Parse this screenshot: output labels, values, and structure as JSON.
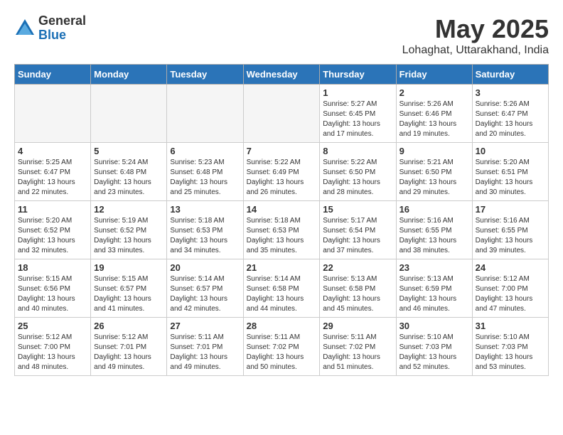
{
  "logo": {
    "general": "General",
    "blue": "Blue"
  },
  "title": "May 2025",
  "location": "Lohaghat, Uttarakhand, India",
  "headers": [
    "Sunday",
    "Monday",
    "Tuesday",
    "Wednesday",
    "Thursday",
    "Friday",
    "Saturday"
  ],
  "weeks": [
    [
      {
        "day": "",
        "info": ""
      },
      {
        "day": "",
        "info": ""
      },
      {
        "day": "",
        "info": ""
      },
      {
        "day": "",
        "info": ""
      },
      {
        "day": "1",
        "info": "Sunrise: 5:27 AM\nSunset: 6:45 PM\nDaylight: 13 hours\nand 17 minutes."
      },
      {
        "day": "2",
        "info": "Sunrise: 5:26 AM\nSunset: 6:46 PM\nDaylight: 13 hours\nand 19 minutes."
      },
      {
        "day": "3",
        "info": "Sunrise: 5:26 AM\nSunset: 6:47 PM\nDaylight: 13 hours\nand 20 minutes."
      }
    ],
    [
      {
        "day": "4",
        "info": "Sunrise: 5:25 AM\nSunset: 6:47 PM\nDaylight: 13 hours\nand 22 minutes."
      },
      {
        "day": "5",
        "info": "Sunrise: 5:24 AM\nSunset: 6:48 PM\nDaylight: 13 hours\nand 23 minutes."
      },
      {
        "day": "6",
        "info": "Sunrise: 5:23 AM\nSunset: 6:48 PM\nDaylight: 13 hours\nand 25 minutes."
      },
      {
        "day": "7",
        "info": "Sunrise: 5:22 AM\nSunset: 6:49 PM\nDaylight: 13 hours\nand 26 minutes."
      },
      {
        "day": "8",
        "info": "Sunrise: 5:22 AM\nSunset: 6:50 PM\nDaylight: 13 hours\nand 28 minutes."
      },
      {
        "day": "9",
        "info": "Sunrise: 5:21 AM\nSunset: 6:50 PM\nDaylight: 13 hours\nand 29 minutes."
      },
      {
        "day": "10",
        "info": "Sunrise: 5:20 AM\nSunset: 6:51 PM\nDaylight: 13 hours\nand 30 minutes."
      }
    ],
    [
      {
        "day": "11",
        "info": "Sunrise: 5:20 AM\nSunset: 6:52 PM\nDaylight: 13 hours\nand 32 minutes."
      },
      {
        "day": "12",
        "info": "Sunrise: 5:19 AM\nSunset: 6:52 PM\nDaylight: 13 hours\nand 33 minutes."
      },
      {
        "day": "13",
        "info": "Sunrise: 5:18 AM\nSunset: 6:53 PM\nDaylight: 13 hours\nand 34 minutes."
      },
      {
        "day": "14",
        "info": "Sunrise: 5:18 AM\nSunset: 6:53 PM\nDaylight: 13 hours\nand 35 minutes."
      },
      {
        "day": "15",
        "info": "Sunrise: 5:17 AM\nSunset: 6:54 PM\nDaylight: 13 hours\nand 37 minutes."
      },
      {
        "day": "16",
        "info": "Sunrise: 5:16 AM\nSunset: 6:55 PM\nDaylight: 13 hours\nand 38 minutes."
      },
      {
        "day": "17",
        "info": "Sunrise: 5:16 AM\nSunset: 6:55 PM\nDaylight: 13 hours\nand 39 minutes."
      }
    ],
    [
      {
        "day": "18",
        "info": "Sunrise: 5:15 AM\nSunset: 6:56 PM\nDaylight: 13 hours\nand 40 minutes."
      },
      {
        "day": "19",
        "info": "Sunrise: 5:15 AM\nSunset: 6:57 PM\nDaylight: 13 hours\nand 41 minutes."
      },
      {
        "day": "20",
        "info": "Sunrise: 5:14 AM\nSunset: 6:57 PM\nDaylight: 13 hours\nand 42 minutes."
      },
      {
        "day": "21",
        "info": "Sunrise: 5:14 AM\nSunset: 6:58 PM\nDaylight: 13 hours\nand 44 minutes."
      },
      {
        "day": "22",
        "info": "Sunrise: 5:13 AM\nSunset: 6:58 PM\nDaylight: 13 hours\nand 45 minutes."
      },
      {
        "day": "23",
        "info": "Sunrise: 5:13 AM\nSunset: 6:59 PM\nDaylight: 13 hours\nand 46 minutes."
      },
      {
        "day": "24",
        "info": "Sunrise: 5:12 AM\nSunset: 7:00 PM\nDaylight: 13 hours\nand 47 minutes."
      }
    ],
    [
      {
        "day": "25",
        "info": "Sunrise: 5:12 AM\nSunset: 7:00 PM\nDaylight: 13 hours\nand 48 minutes."
      },
      {
        "day": "26",
        "info": "Sunrise: 5:12 AM\nSunset: 7:01 PM\nDaylight: 13 hours\nand 49 minutes."
      },
      {
        "day": "27",
        "info": "Sunrise: 5:11 AM\nSunset: 7:01 PM\nDaylight: 13 hours\nand 49 minutes."
      },
      {
        "day": "28",
        "info": "Sunrise: 5:11 AM\nSunset: 7:02 PM\nDaylight: 13 hours\nand 50 minutes."
      },
      {
        "day": "29",
        "info": "Sunrise: 5:11 AM\nSunset: 7:02 PM\nDaylight: 13 hours\nand 51 minutes."
      },
      {
        "day": "30",
        "info": "Sunrise: 5:10 AM\nSunset: 7:03 PM\nDaylight: 13 hours\nand 52 minutes."
      },
      {
        "day": "31",
        "info": "Sunrise: 5:10 AM\nSunset: 7:03 PM\nDaylight: 13 hours\nand 53 minutes."
      }
    ]
  ]
}
